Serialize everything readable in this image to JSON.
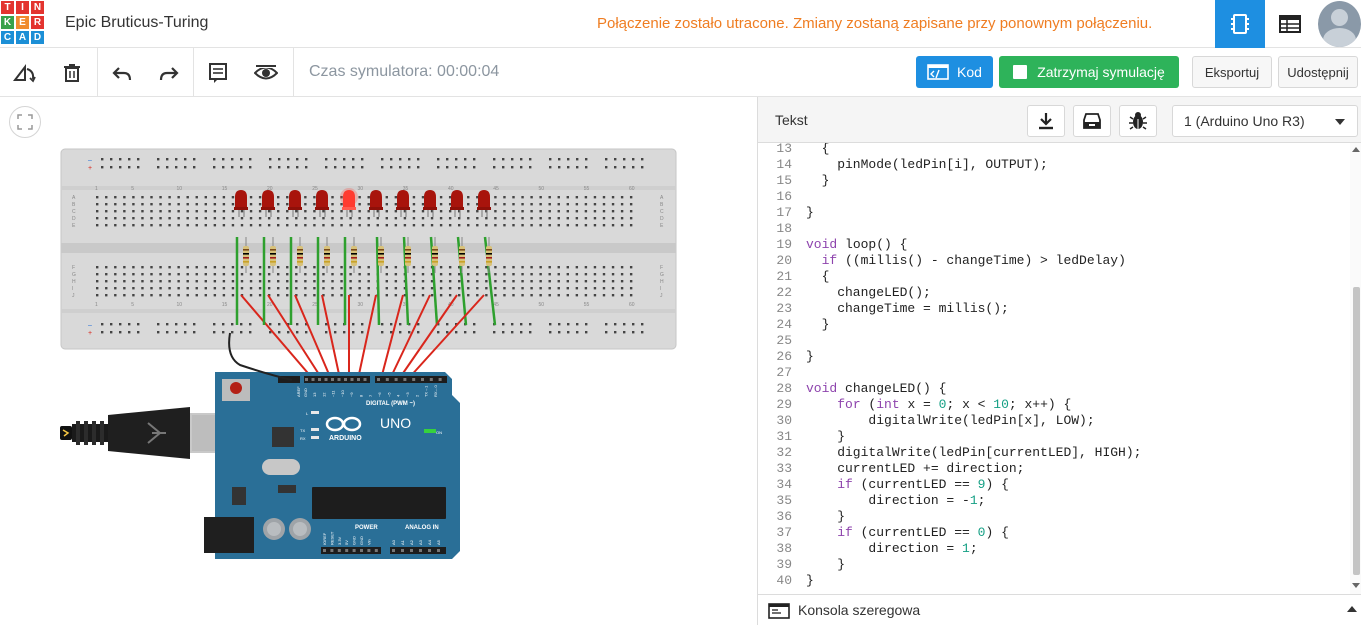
{
  "app": {
    "logo_letters": [
      "T",
      "I",
      "N",
      "K",
      "E",
      "R",
      "C",
      "A",
      "D"
    ],
    "logo_colors": [
      "#e3342f",
      "#e3342f",
      "#e3342f",
      "#38a24b",
      "#f08c2f",
      "#e3342f",
      "#1c8fd6",
      "#1c8fd6",
      "#1c8fd6"
    ],
    "project_title": "Epic Bruticus-Turing",
    "connection_message": "Połączenie zostało utracone. Zmiany zostaną zapisane przy ponownym połączeniu.",
    "accent_color": "#1e8fe1",
    "warning_color": "#ef7d22"
  },
  "toolbar": {
    "simulator_time": "Czas symulatora: 00:00:04",
    "code_label": "Kod",
    "stop_label": "Zatrzymaj symulację",
    "export_label": "Eksportuj",
    "share_label": "Udostępnij",
    "stop_color": "#2eb35a"
  },
  "code_panel": {
    "mode_label": "Tekst",
    "device_select": "1 (Arduino Uno R3)",
    "serial_label": "Konsola szeregowa",
    "lines": [
      {
        "n": "13",
        "html": "  {"
      },
      {
        "n": "14",
        "html": "    pinMode(ledPin[i], OUTPUT);"
      },
      {
        "n": "15",
        "html": "  }"
      },
      {
        "n": "16",
        "html": ""
      },
      {
        "n": "17",
        "html": "}"
      },
      {
        "n": "18",
        "html": ""
      },
      {
        "n": "19",
        "html": "<span class=\"kw\">void</span> loop() {"
      },
      {
        "n": "20",
        "html": "  <span class=\"kw\">if</span> ((millis() - changeTime) > ledDelay)"
      },
      {
        "n": "21",
        "html": "  {"
      },
      {
        "n": "22",
        "html": "    changeLED();"
      },
      {
        "n": "23",
        "html": "    changeTime = millis();"
      },
      {
        "n": "24",
        "html": "  }"
      },
      {
        "n": "25",
        "html": ""
      },
      {
        "n": "26",
        "html": "}"
      },
      {
        "n": "27",
        "html": ""
      },
      {
        "n": "28",
        "html": "<span class=\"kw\">void</span> changeLED() {"
      },
      {
        "n": "29",
        "html": "    <span class=\"kw\">for</span> (<span class=\"kw\">int</span> x = <span class=\"num\">0</span>; x < <span class=\"num\">10</span>; x++) {"
      },
      {
        "n": "30",
        "html": "        digitalWrite(ledPin[x], LOW);"
      },
      {
        "n": "31",
        "html": "    }"
      },
      {
        "n": "32",
        "html": "    digitalWrite(ledPin[currentLED], HIGH);"
      },
      {
        "n": "33",
        "html": "    currentLED += direction;"
      },
      {
        "n": "34",
        "html": "    <span class=\"kw\">if</span> (currentLED == <span class=\"num\">9</span>) {"
      },
      {
        "n": "35",
        "html": "        direction = -<span class=\"num\">1</span>;"
      },
      {
        "n": "36",
        "html": "    }"
      },
      {
        "n": "37",
        "html": "    <span class=\"kw\">if</span> (currentLED == <span class=\"num\">0</span>) {"
      },
      {
        "n": "38",
        "html": "        direction = <span class=\"num\">1</span>;"
      },
      {
        "n": "39",
        "html": "    }"
      },
      {
        "n": "40",
        "html": "}"
      }
    ]
  },
  "circuit": {
    "breadboard_col_numbers": [
      "1",
      "5",
      "10",
      "15",
      "20",
      "25",
      "30",
      "35",
      "40",
      "45",
      "50",
      "55",
      "60"
    ],
    "row_letters_top": [
      "A",
      "B",
      "C",
      "D",
      "E"
    ],
    "row_letters_bottom": [
      "F",
      "G",
      "H",
      "I",
      "J"
    ],
    "led_count": 10,
    "lit_led_index": 4,
    "board_name": "UNO",
    "board_brand": "ARDUINO",
    "digital_label": "DIGITAL (PWM ~)",
    "power_label": "POWER",
    "analog_label": "ANALOG IN",
    "on_label": "ON",
    "tx_label": "TX",
    "rx_label": "RX",
    "l_label": "L",
    "aref_label": "AREF",
    "gnd_label": "GND",
    "digital_pins": [
      "13",
      "12",
      "~11",
      "~10",
      "~9",
      "8",
      "7",
      "~6",
      "~5",
      "4",
      "~3",
      "2",
      "TX→1",
      "RX←0"
    ],
    "power_pins": [
      "IOREF",
      "RESET",
      "3.3V",
      "5V",
      "GND",
      "GND",
      "Vin"
    ],
    "analog_pins": [
      "A0",
      "A1",
      "A2",
      "A3",
      "A4",
      "A5"
    ],
    "board_color": "#2a6f97",
    "wire_red": "#d9261c",
    "wire_green": "#2ea02e"
  }
}
